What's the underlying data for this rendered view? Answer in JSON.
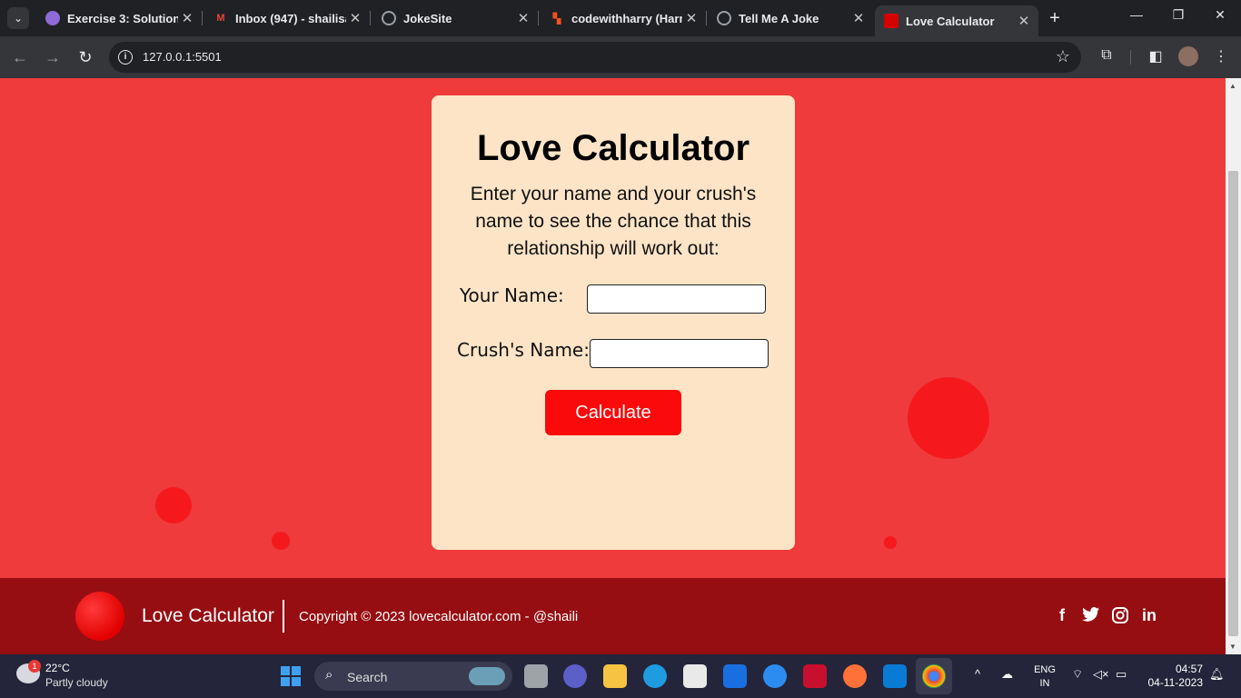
{
  "browser": {
    "tabs": [
      {
        "title": "Exercise 3: Solution &",
        "favicon_color": "#8e6bd6"
      },
      {
        "title": "Inbox (947) - shailisa",
        "favicon_color": "#ea4335"
      },
      {
        "title": "JokeSite",
        "favicon_color": "#9aa0a6"
      },
      {
        "title": "codewithharry (Harr",
        "favicon_color": "#f4511e"
      },
      {
        "title": "Tell Me A Joke",
        "favicon_color": "#9aa0a6"
      },
      {
        "title": "Love Calculator",
        "favicon_color": "#d50000"
      }
    ],
    "url": "127.0.0.1:5501"
  },
  "page": {
    "card": {
      "title": "Love Calculator",
      "description": "Enter your name and your crush's name to see the chance that this relationship will work out:",
      "your_name_label": "Your Name:",
      "your_name_value": "",
      "crush_name_label": "Crush's Name:",
      "crush_name_value": "",
      "calculate_label": "Calculate"
    },
    "footer": {
      "brand": "Love Calculator",
      "copyright": "Copyright © 2023 lovecalculator.com - @shaili",
      "social": [
        "facebook-icon",
        "twitter-icon",
        "instagram-icon",
        "linkedin-icon"
      ]
    }
  },
  "taskbar": {
    "weather_badge": "1",
    "temperature": "22°C",
    "weather": "Partly cloudy",
    "search_label": "Search",
    "language_line1": "ENG",
    "language_line2": "IN",
    "time": "04:57",
    "date": "04-11-2023"
  },
  "colors": {
    "page_background": "#ef3b3b",
    "card_background": "#fde4c7",
    "button": "#fa0a0a",
    "footer_background": "#960e12"
  }
}
